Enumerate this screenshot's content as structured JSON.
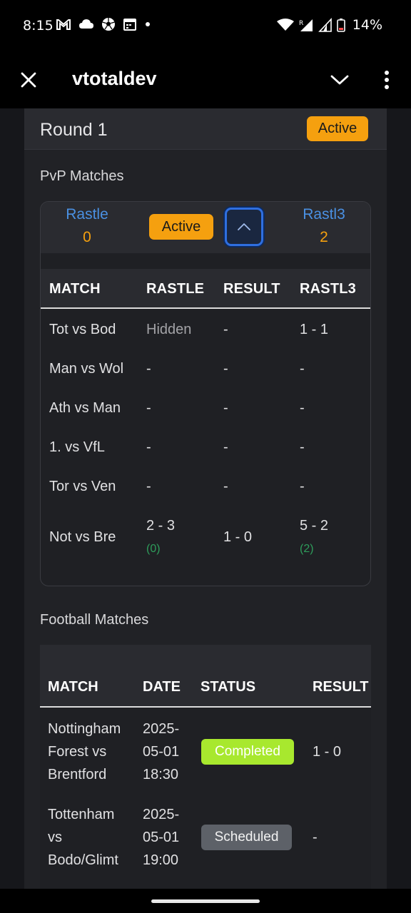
{
  "status_bar": {
    "time": "8:15",
    "battery": "14%",
    "icons_left": [
      "gmail-icon",
      "cloud-icon",
      "soccer-ball-icon",
      "calendar-icon",
      "dot-icon"
    ],
    "icons_right": [
      "wifi-icon",
      "signal-icon",
      "signal-icon-2",
      "battery-icon"
    ]
  },
  "app_bar": {
    "title": "vtotaldev"
  },
  "round": {
    "title": "Round 1",
    "status": "Active"
  },
  "pvp": {
    "section_title": "PvP Matches",
    "player1": {
      "name": "Rastle",
      "score": "0"
    },
    "player2": {
      "name": "Rastl3",
      "score": "2"
    },
    "status": "Active",
    "columns": [
      "MATCH",
      "RASTLE",
      "RESULT",
      "RASTL3"
    ],
    "rows": [
      {
        "match": "Tot vs Bod",
        "p1": "Hidden",
        "result": "-",
        "p2": "1 - 1",
        "p1_pts": "",
        "p2_pts": ""
      },
      {
        "match": "Man vs Wol",
        "p1": "-",
        "result": "-",
        "p2": "-",
        "p1_pts": "",
        "p2_pts": ""
      },
      {
        "match": "Ath vs Man",
        "p1": "-",
        "result": "-",
        "p2": "-",
        "p1_pts": "",
        "p2_pts": ""
      },
      {
        "match": "1. vs VfL",
        "p1": "-",
        "result": "-",
        "p2": "-",
        "p1_pts": "",
        "p2_pts": ""
      },
      {
        "match": "Tor vs Ven",
        "p1": "-",
        "result": "-",
        "p2": "-",
        "p1_pts": "",
        "p2_pts": ""
      },
      {
        "match": "Not vs Bre",
        "p1": "2 - 3",
        "result": "1 - 0",
        "p2": "5 - 2",
        "p1_pts": "(0)",
        "p2_pts": "(2)"
      }
    ]
  },
  "football": {
    "section_title": "Football Matches",
    "columns": [
      "MATCH",
      "DATE",
      "STATUS",
      "RESULT"
    ],
    "rows": [
      {
        "match": [
          "Nottingham",
          "Forest vs",
          "Brentford"
        ],
        "date": [
          "2025-",
          "05-01",
          "18:30"
        ],
        "status": "Completed",
        "result": "1 - 0"
      },
      {
        "match": [
          "Tottenham",
          "vs",
          "Bodo/Glimt"
        ],
        "date": [
          "2025-",
          "05-01",
          "19:00"
        ],
        "status": "Scheduled",
        "result": "-"
      }
    ]
  },
  "colors": {
    "accent_orange": "#f5a00f",
    "player_blue": "#4a90e2",
    "completed_green": "#a8e82e",
    "points_green": "#2e9d5b"
  }
}
